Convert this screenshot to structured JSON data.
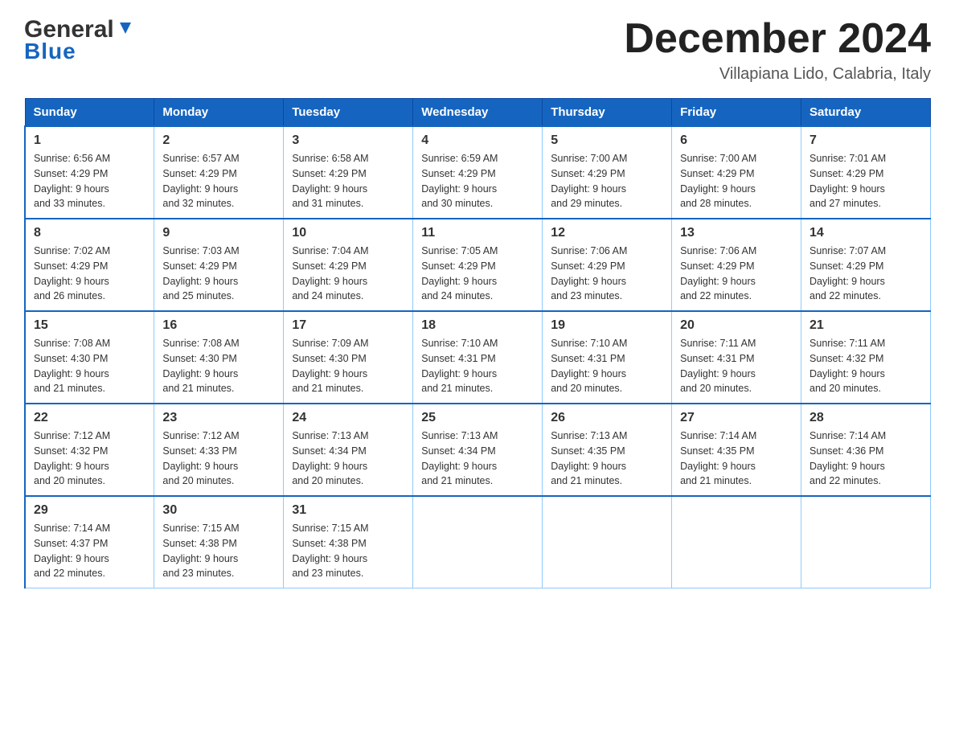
{
  "header": {
    "logo_general": "General",
    "logo_blue": "Blue",
    "month_title": "December 2024",
    "subtitle": "Villapiana Lido, Calabria, Italy"
  },
  "days_of_week": [
    "Sunday",
    "Monday",
    "Tuesday",
    "Wednesday",
    "Thursday",
    "Friday",
    "Saturday"
  ],
  "weeks": [
    [
      {
        "day": "1",
        "sunrise": "6:56 AM",
        "sunset": "4:29 PM",
        "daylight": "9 hours and 33 minutes."
      },
      {
        "day": "2",
        "sunrise": "6:57 AM",
        "sunset": "4:29 PM",
        "daylight": "9 hours and 32 minutes."
      },
      {
        "day": "3",
        "sunrise": "6:58 AM",
        "sunset": "4:29 PM",
        "daylight": "9 hours and 31 minutes."
      },
      {
        "day": "4",
        "sunrise": "6:59 AM",
        "sunset": "4:29 PM",
        "daylight": "9 hours and 30 minutes."
      },
      {
        "day": "5",
        "sunrise": "7:00 AM",
        "sunset": "4:29 PM",
        "daylight": "9 hours and 29 minutes."
      },
      {
        "day": "6",
        "sunrise": "7:00 AM",
        "sunset": "4:29 PM",
        "daylight": "9 hours and 28 minutes."
      },
      {
        "day": "7",
        "sunrise": "7:01 AM",
        "sunset": "4:29 PM",
        "daylight": "9 hours and 27 minutes."
      }
    ],
    [
      {
        "day": "8",
        "sunrise": "7:02 AM",
        "sunset": "4:29 PM",
        "daylight": "9 hours and 26 minutes."
      },
      {
        "day": "9",
        "sunrise": "7:03 AM",
        "sunset": "4:29 PM",
        "daylight": "9 hours and 25 minutes."
      },
      {
        "day": "10",
        "sunrise": "7:04 AM",
        "sunset": "4:29 PM",
        "daylight": "9 hours and 24 minutes."
      },
      {
        "day": "11",
        "sunrise": "7:05 AM",
        "sunset": "4:29 PM",
        "daylight": "9 hours and 24 minutes."
      },
      {
        "day": "12",
        "sunrise": "7:06 AM",
        "sunset": "4:29 PM",
        "daylight": "9 hours and 23 minutes."
      },
      {
        "day": "13",
        "sunrise": "7:06 AM",
        "sunset": "4:29 PM",
        "daylight": "9 hours and 22 minutes."
      },
      {
        "day": "14",
        "sunrise": "7:07 AM",
        "sunset": "4:29 PM",
        "daylight": "9 hours and 22 minutes."
      }
    ],
    [
      {
        "day": "15",
        "sunrise": "7:08 AM",
        "sunset": "4:30 PM",
        "daylight": "9 hours and 21 minutes."
      },
      {
        "day": "16",
        "sunrise": "7:08 AM",
        "sunset": "4:30 PM",
        "daylight": "9 hours and 21 minutes."
      },
      {
        "day": "17",
        "sunrise": "7:09 AM",
        "sunset": "4:30 PM",
        "daylight": "9 hours and 21 minutes."
      },
      {
        "day": "18",
        "sunrise": "7:10 AM",
        "sunset": "4:31 PM",
        "daylight": "9 hours and 21 minutes."
      },
      {
        "day": "19",
        "sunrise": "7:10 AM",
        "sunset": "4:31 PM",
        "daylight": "9 hours and 20 minutes."
      },
      {
        "day": "20",
        "sunrise": "7:11 AM",
        "sunset": "4:31 PM",
        "daylight": "9 hours and 20 minutes."
      },
      {
        "day": "21",
        "sunrise": "7:11 AM",
        "sunset": "4:32 PM",
        "daylight": "9 hours and 20 minutes."
      }
    ],
    [
      {
        "day": "22",
        "sunrise": "7:12 AM",
        "sunset": "4:32 PM",
        "daylight": "9 hours and 20 minutes."
      },
      {
        "day": "23",
        "sunrise": "7:12 AM",
        "sunset": "4:33 PM",
        "daylight": "9 hours and 20 minutes."
      },
      {
        "day": "24",
        "sunrise": "7:13 AM",
        "sunset": "4:34 PM",
        "daylight": "9 hours and 20 minutes."
      },
      {
        "day": "25",
        "sunrise": "7:13 AM",
        "sunset": "4:34 PM",
        "daylight": "9 hours and 21 minutes."
      },
      {
        "day": "26",
        "sunrise": "7:13 AM",
        "sunset": "4:35 PM",
        "daylight": "9 hours and 21 minutes."
      },
      {
        "day": "27",
        "sunrise": "7:14 AM",
        "sunset": "4:35 PM",
        "daylight": "9 hours and 21 minutes."
      },
      {
        "day": "28",
        "sunrise": "7:14 AM",
        "sunset": "4:36 PM",
        "daylight": "9 hours and 22 minutes."
      }
    ],
    [
      {
        "day": "29",
        "sunrise": "7:14 AM",
        "sunset": "4:37 PM",
        "daylight": "9 hours and 22 minutes."
      },
      {
        "day": "30",
        "sunrise": "7:15 AM",
        "sunset": "4:38 PM",
        "daylight": "9 hours and 23 minutes."
      },
      {
        "day": "31",
        "sunrise": "7:15 AM",
        "sunset": "4:38 PM",
        "daylight": "9 hours and 23 minutes."
      },
      null,
      null,
      null,
      null
    ]
  ],
  "labels": {
    "sunrise": "Sunrise:",
    "sunset": "Sunset:",
    "daylight": "Daylight:"
  },
  "colors": {
    "header_bg": "#1565c0",
    "header_border": "#0d47a1",
    "cell_border": "#90caf9",
    "row_border": "#1565c0"
  }
}
